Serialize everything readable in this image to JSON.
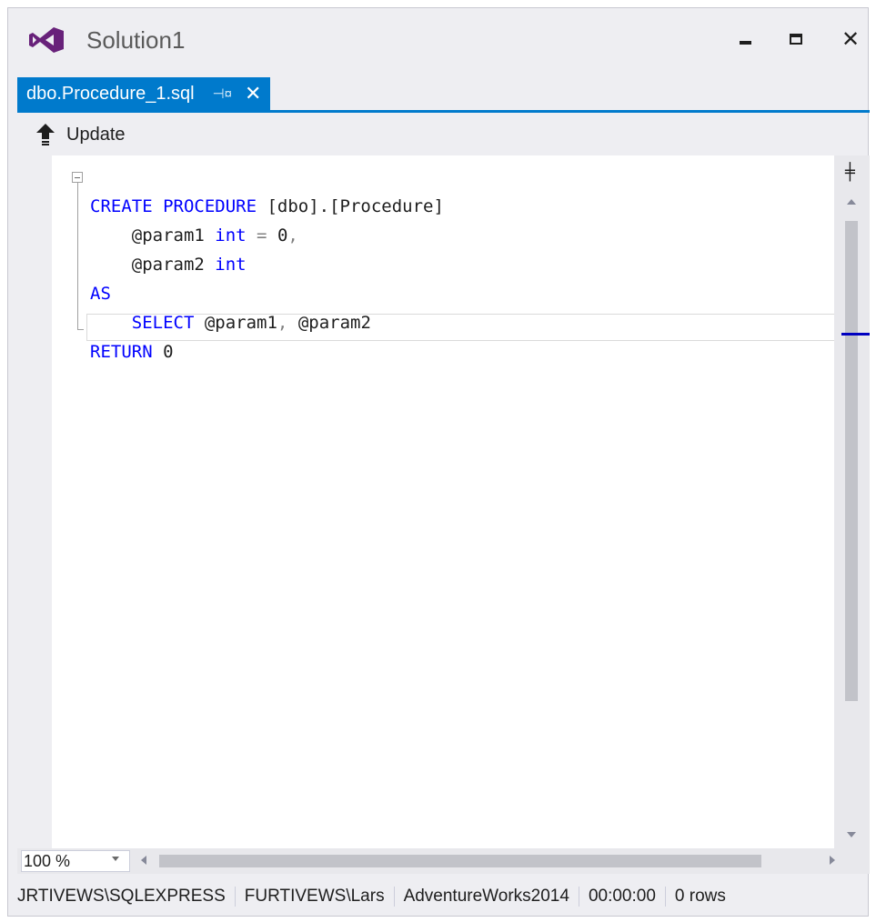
{
  "window": {
    "title": "Solution1",
    "accent": "#007acc",
    "logo_color": "#68217a"
  },
  "tab": {
    "label": "dbo.Procedure_1.sql",
    "pin_icon": "pin-icon",
    "close_icon": "close-icon"
  },
  "toolbar": {
    "update_label": "Update",
    "update_icon": "arrow-up-icon"
  },
  "code": {
    "line1": {
      "kw1": "CREATE PROCEDURE",
      "rest": " [dbo].[Procedure]"
    },
    "line2": {
      "indent": "    ",
      "p1": "@param1 ",
      "kw": "int",
      "op": " = ",
      "val": "0",
      "comma": ","
    },
    "line3": {
      "indent": "    ",
      "p2": "@param2 ",
      "kw": "int"
    },
    "line4": {
      "kw": "AS"
    },
    "line5": {
      "indent": "    ",
      "kw": "SELECT",
      "p": " @param1",
      "comma": ",",
      "p2": " @param2"
    },
    "line6": {
      "kw": "RETURN",
      "val": " 0"
    }
  },
  "zoom": {
    "value": "100 %"
  },
  "status": {
    "server": "JRTIVEWS\\SQLEXPRESS",
    "user": "FURTIVEWS\\Lars",
    "database": "AdventureWorks2014",
    "elapsed": "00:00:00",
    "rows": "0 rows"
  }
}
